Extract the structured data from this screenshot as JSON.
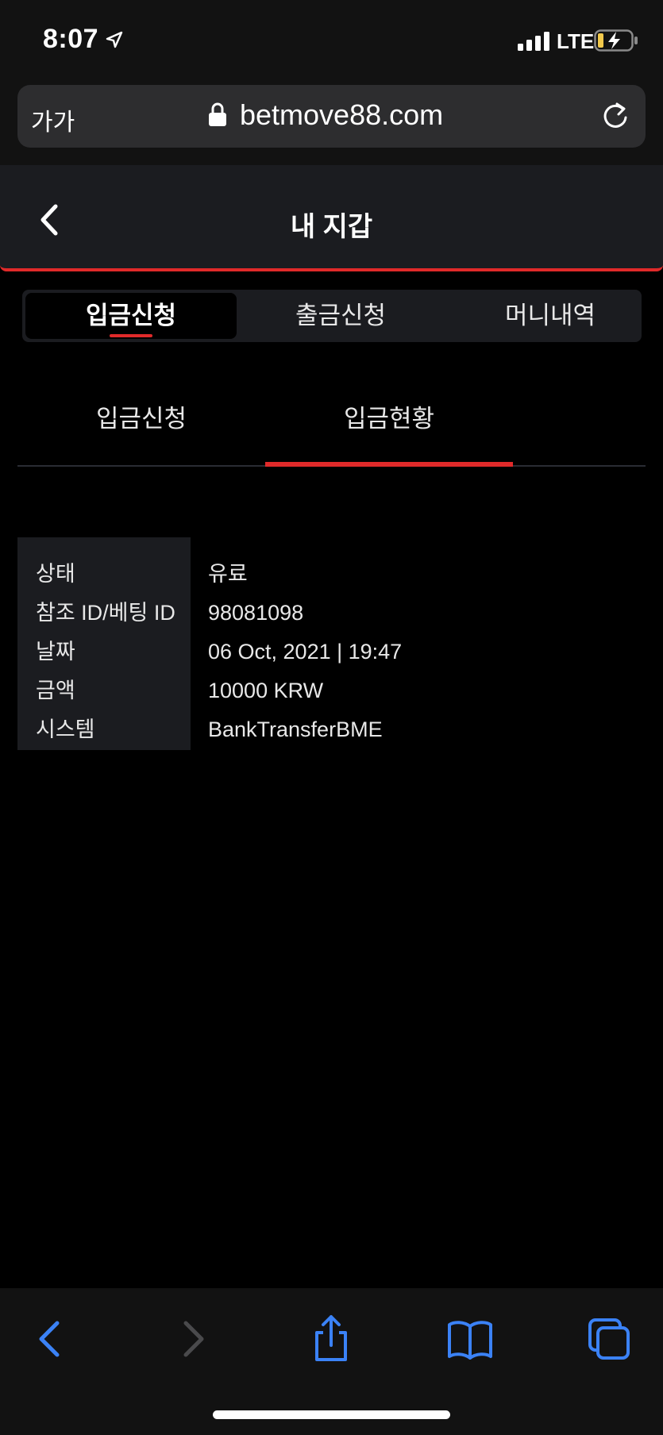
{
  "status_bar": {
    "time": "8:07",
    "network": "LTE"
  },
  "browser": {
    "text_size_label": "가가",
    "url": "betmove88.com"
  },
  "header": {
    "title": "내 지갑"
  },
  "main_tabs": [
    {
      "label": "입금신청",
      "active": true
    },
    {
      "label": "출금신청",
      "active": false
    },
    {
      "label": "머니내역",
      "active": false
    }
  ],
  "sub_tabs": [
    {
      "label": "입금신청",
      "active": false
    },
    {
      "label": "입금현황",
      "active": true
    }
  ],
  "details": {
    "rows": [
      {
        "label": "상태",
        "value": "유료"
      },
      {
        "label": "참조 ID/베팅 ID",
        "value": "98081098"
      },
      {
        "label": "날짜",
        "value": "06 Oct, 2021 | 19:47"
      },
      {
        "label": "금액",
        "value": "10000 KRW"
      },
      {
        "label": "시스템",
        "value": "BankTransferBME"
      }
    ]
  },
  "colors": {
    "accent": "#e02a2a",
    "panel": "#1b1c20",
    "background": "#000000",
    "browser_blue": "#3b82f6"
  }
}
